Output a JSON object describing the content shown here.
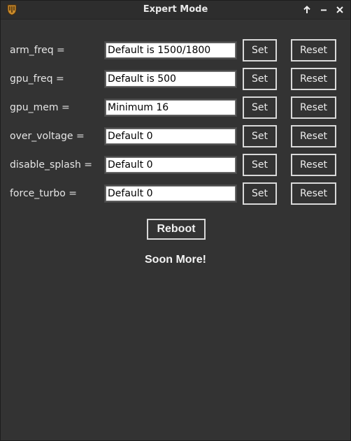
{
  "window": {
    "title": "Expert Mode",
    "icons": {
      "app": "shield-icon",
      "maximize": "arrow-up-icon",
      "minimize": "minus-icon",
      "close": "close-icon"
    }
  },
  "settings": [
    {
      "key": "arm_freq",
      "label": "arm_freq =",
      "value": "Default is 1500/1800",
      "set_label": "Set",
      "reset_label": "Reset"
    },
    {
      "key": "gpu_freq",
      "label": "gpu_freq =",
      "value": "Default is 500",
      "set_label": "Set",
      "reset_label": "Reset"
    },
    {
      "key": "gpu_mem",
      "label": "gpu_mem =",
      "value": "Minimum 16",
      "set_label": "Set",
      "reset_label": "Reset"
    },
    {
      "key": "over_voltage",
      "label": "over_voltage =",
      "value": "Default 0",
      "set_label": "Set",
      "reset_label": "Reset"
    },
    {
      "key": "disable_splash",
      "label": "disable_splash =",
      "value": "Default 0",
      "set_label": "Set",
      "reset_label": "Reset"
    },
    {
      "key": "force_turbo",
      "label": "force_turbo =",
      "value": "Default 0",
      "set_label": "Set",
      "reset_label": "Reset"
    }
  ],
  "reboot_label": "Reboot",
  "footer_text": "Soon More!",
  "colors": {
    "background": "#333333",
    "titlebar": "#2d2d2d",
    "text": "#e6e6e6",
    "button_border": "#d9d9d9",
    "input_background": "#ffffff"
  }
}
